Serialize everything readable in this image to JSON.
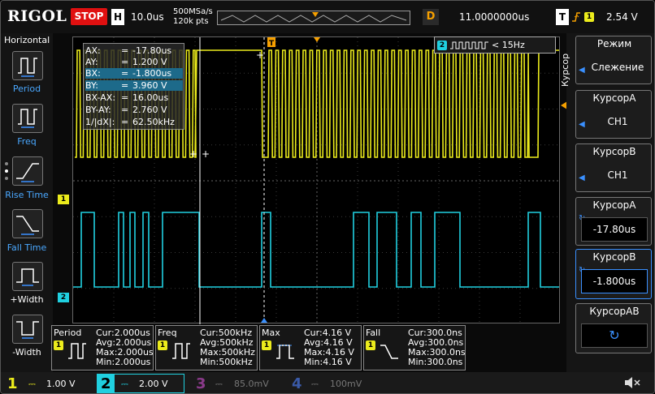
{
  "app": {
    "brand": "RIGOL",
    "run_state": "STOP"
  },
  "timebase": {
    "badge": "H",
    "scale": "10.0us",
    "sample_rate": "500MSa/s",
    "points": "120k pts"
  },
  "delay": {
    "badge": "D",
    "value": "11.0000000us"
  },
  "trigger": {
    "badge": "T",
    "source": "1",
    "level": "2.54 V"
  },
  "horizontal_panel": {
    "title": "Horizontal",
    "items": [
      {
        "label": "Period"
      },
      {
        "label": "Freq"
      },
      {
        "label": "Rise Time"
      },
      {
        "label": "Fall Time"
      },
      {
        "label": "+Width"
      },
      {
        "label": "-Width"
      }
    ]
  },
  "cursor_readout": {
    "rows": [
      {
        "key": "AX:",
        "eq": "=",
        "value": "-17.80us"
      },
      {
        "key": "AY:",
        "eq": "=",
        "value": "1.200 V"
      },
      {
        "key": "BX:",
        "eq": "=",
        "value": "-1.800us"
      },
      {
        "key": "BY:",
        "eq": "=",
        "value": "3.960 V"
      },
      {
        "key": "BX-AX:",
        "eq": "=",
        "value": "16.00us"
      },
      {
        "key": "BY-AY:",
        "eq": "=",
        "value": "2.760 V"
      },
      {
        "key": "1/|dX|:",
        "eq": "=",
        "value": "62.50kHz"
      }
    ]
  },
  "counter": {
    "channel": "2",
    "text": "< 15Hz"
  },
  "cursor_menu": {
    "vertical_label": "Курсор",
    "blocks": [
      {
        "title": "Режим",
        "value": "Слежение"
      },
      {
        "title": "КурсорA",
        "value": "CH1"
      },
      {
        "title": "КурсорB",
        "value": "CH1"
      },
      {
        "title": "КурсорA",
        "value": "-17.80us"
      },
      {
        "title": "КурсорB",
        "value": "-1.800us"
      },
      {
        "title": "КурсорAB",
        "value": ""
      }
    ]
  },
  "measurements": [
    {
      "title": "Period",
      "cur": "Cur:2.000us",
      "avg": "Avg:2.000us",
      "max": "Max:2.000us",
      "min": "Min:2.000us"
    },
    {
      "title": "Freq",
      "cur": "Cur:500kHz",
      "avg": "Avg:500kHz",
      "max": "Max:500kHz",
      "min": "Min:500kHz"
    },
    {
      "title": "Max",
      "cur": "Cur:4.16 V",
      "avg": "Avg:4.16 V",
      "max": "Max:4.16 V",
      "min": "Min:4.16 V"
    },
    {
      "title": "Fall",
      "cur": "Cur:300.0ns",
      "avg": "Avg:300.0ns",
      "max": "Max:300.0ns",
      "min": "Min:300.0ns"
    }
  ],
  "measurement_channel": "1",
  "channels": [
    {
      "num": "1",
      "scale": "1.00 V",
      "color": "#ecec1c"
    },
    {
      "num": "2",
      "scale": "2.00 V",
      "color": "#20d0e0"
    },
    {
      "num": "3",
      "scale": "85.0mV",
      "color": "#d040d0"
    },
    {
      "num": "4",
      "scale": "100mV",
      "color": "#3a70ff"
    }
  ],
  "trace_markers": {
    "ch1": "1",
    "ch2": "2"
  },
  "colors": {
    "ch1": "#ecec1c",
    "ch2": "#20d0e0",
    "trigger": "#f6a000",
    "accent": "#3a90ff",
    "stop": "#e01010"
  },
  "icons": {
    "trigger_edge": "rising-edge-icon",
    "sound": "speaker-mute-icon",
    "cursor_ab": "rotate-icon"
  }
}
